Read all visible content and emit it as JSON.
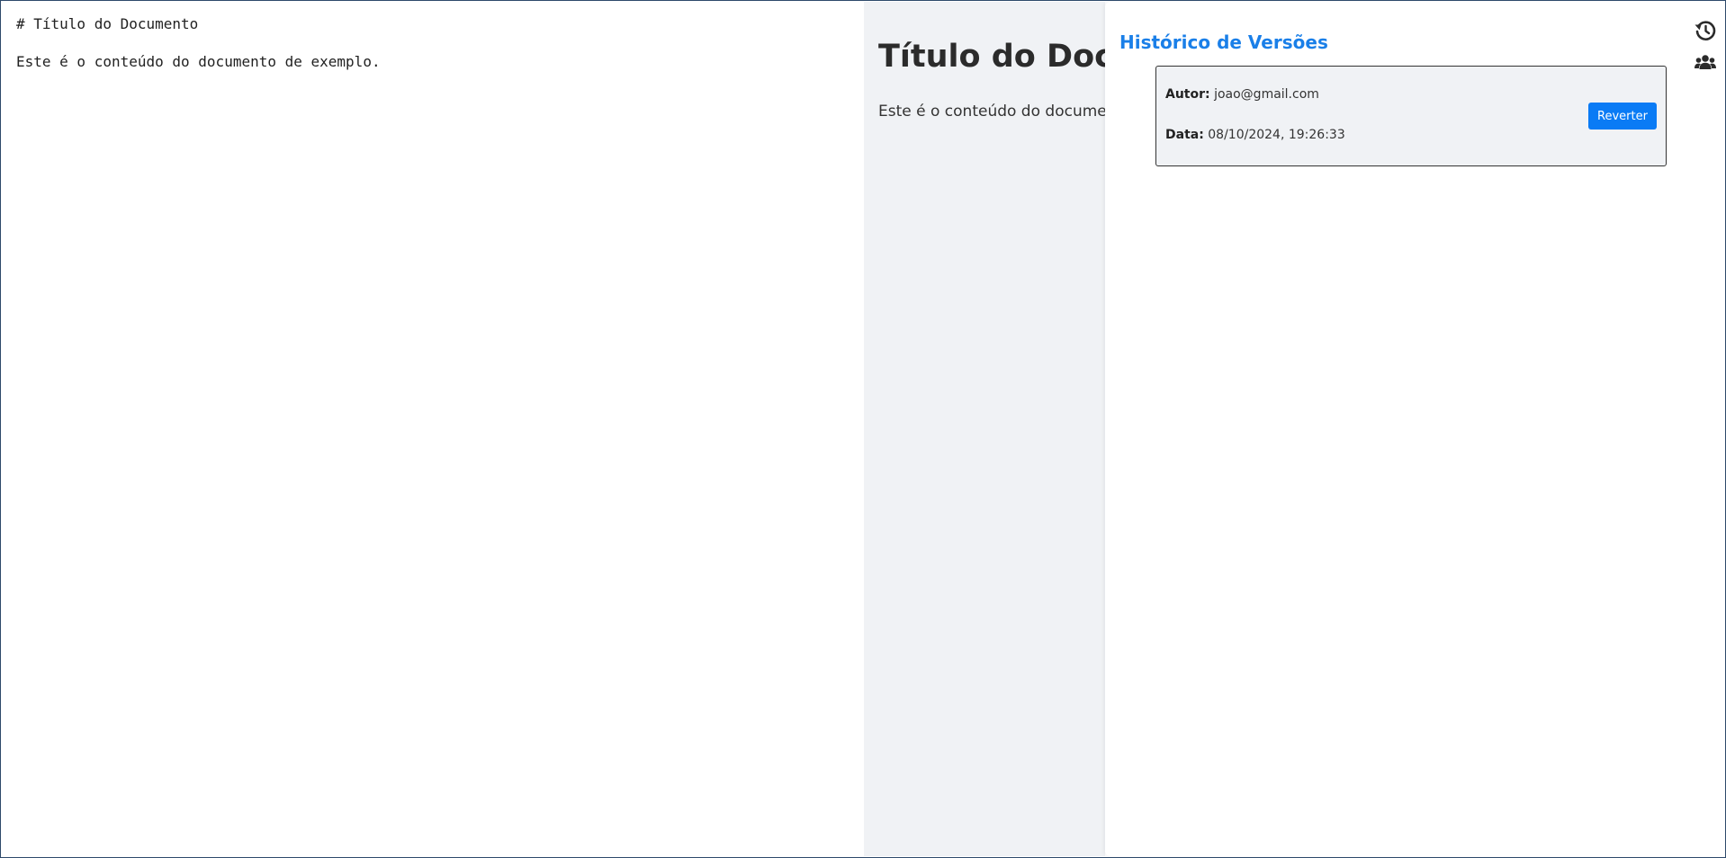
{
  "editor": {
    "lines": [
      "# Título do Documento",
      "",
      "Este é o conteúdo do documento de exemplo."
    ]
  },
  "preview": {
    "heading": "Título do Documento",
    "paragraph": "Este é o conteúdo do documento de exemplo."
  },
  "history": {
    "title": "Histórico de Versões",
    "versions": [
      {
        "author_label": "Autor:",
        "author": "joao@gmail.com",
        "date_label": "Data:",
        "date": "08/10/2024, 19:26:33",
        "revert_label": "Reverter"
      }
    ]
  },
  "rail": {
    "icons": [
      "history-icon",
      "users-icon"
    ]
  },
  "colors": {
    "accent": "#1a7fe8",
    "button": "#0a7bf5",
    "preview_bg": "#f0f2f5"
  }
}
